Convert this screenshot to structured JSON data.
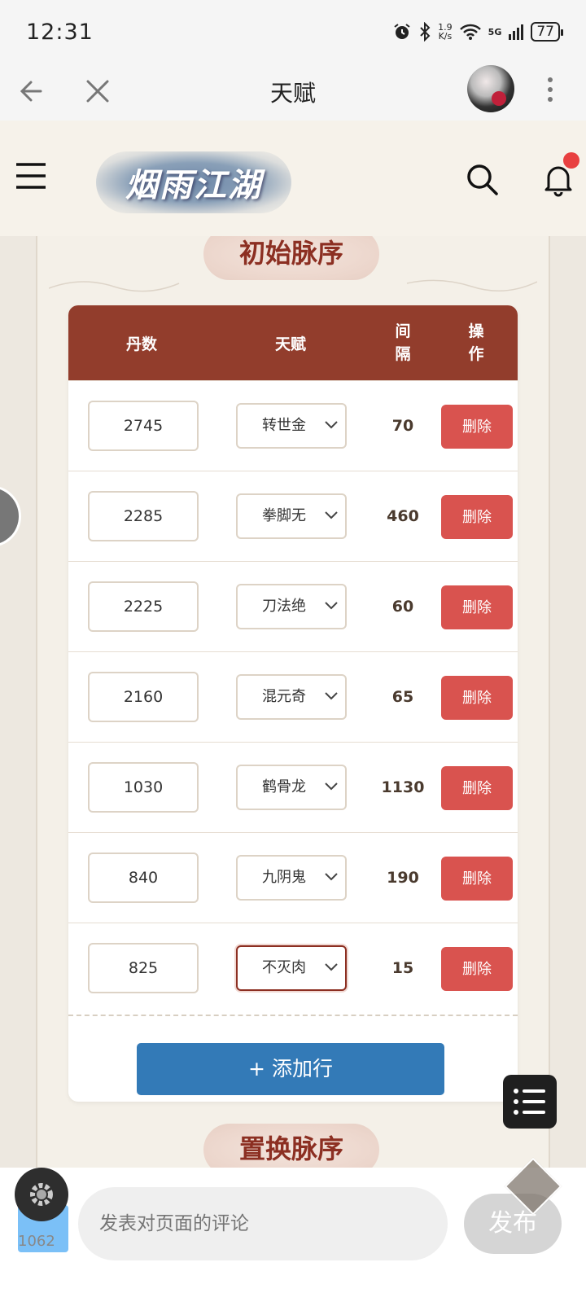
{
  "status_bar": {
    "time": "12:31",
    "net_speed_value": "1.9",
    "net_speed_unit": "K/s",
    "network": "5G",
    "battery": "77"
  },
  "app_bar": {
    "title": "天赋"
  },
  "site_header": {
    "logo_text": "烟雨江湖"
  },
  "section_initial": {
    "title": "初始脉序",
    "headers": {
      "dan": "丹数",
      "talent": "天赋",
      "interval_line1": "间",
      "interval_line2": "隔",
      "op_line1": "操",
      "op_line2": "作"
    },
    "rows": [
      {
        "dan": "2745",
        "talent": "转世金",
        "interval": "70",
        "action": "删除"
      },
      {
        "dan": "2285",
        "talent": "拳脚无",
        "interval": "460",
        "action": "删除"
      },
      {
        "dan": "2225",
        "talent": "刀法绝",
        "interval": "60",
        "action": "删除"
      },
      {
        "dan": "2160",
        "talent": "混元奇",
        "interval": "65",
        "action": "删除"
      },
      {
        "dan": "1030",
        "talent": "鹤骨龙",
        "interval": "1130",
        "action": "删除"
      },
      {
        "dan": "840",
        "talent": "九阴鬼",
        "interval": "190",
        "action": "删除"
      },
      {
        "dan": "825",
        "talent": "不灭肉",
        "interval": "15",
        "action": "删除"
      }
    ],
    "add_row_label": "+ 添加行"
  },
  "section_replace": {
    "title": "置换脉序"
  },
  "comment_bar": {
    "placeholder": "发表对页面的评论",
    "publish_label": "发布",
    "badge_count": "1062"
  },
  "colors": {
    "table_header": "#923d2c",
    "delete_button": "#d9534f",
    "add_button": "#337ab7",
    "section_title_text": "#8c2f22"
  }
}
